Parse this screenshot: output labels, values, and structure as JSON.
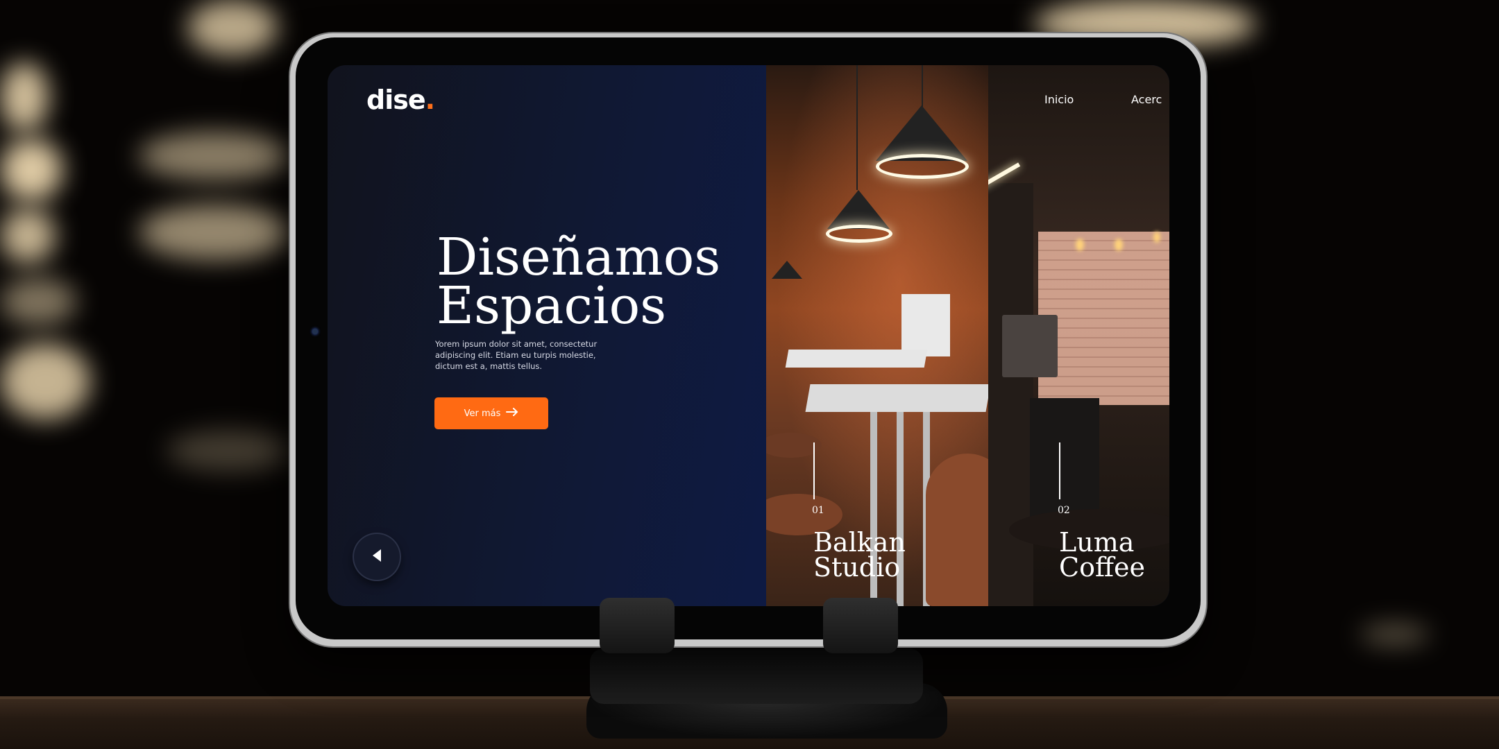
{
  "brand": {
    "logo_text": "dise",
    "logo_dot": ".",
    "accent": "#ff6a13"
  },
  "nav": {
    "items": [
      {
        "label": "Inicio"
      },
      {
        "label": "Acerc"
      }
    ]
  },
  "hero": {
    "title_line1": "Diseñamos",
    "title_line2": "Espacios",
    "text_line1": "Yorem ipsum dolor sit amet, consectetur",
    "text_line2": "adipiscing elit. Etiam eu turpis molestie,",
    "text_line3": "dictum est a, mattis tellus.",
    "cta_label": "Ver más"
  },
  "projects": [
    {
      "number": "01",
      "title_line1": "Balkan",
      "title_line2": "Studio"
    },
    {
      "number": "02",
      "title_line1": "Luma",
      "title_line2": "Coffee"
    }
  ],
  "icons": {
    "cta": "arrow-right-icon",
    "prev": "triangle-left-icon"
  },
  "colors": {
    "screen_bg": "#0e1a45",
    "text": "#ffffff"
  }
}
